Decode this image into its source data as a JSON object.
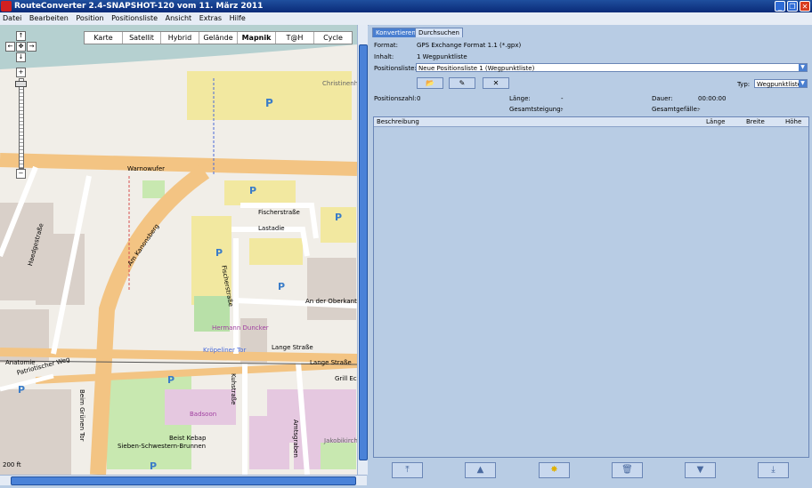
{
  "title": "RouteConverter 2.4-SNAPSHOT-120 vom 11. März 2011",
  "window_controls": {
    "minimize": "_",
    "maximize": "❐",
    "close": "✕"
  },
  "menu": [
    "Datei",
    "Bearbeiten",
    "Position",
    "Positionsliste",
    "Ansicht",
    "Extras",
    "Hilfe"
  ],
  "map": {
    "types": [
      "Karte",
      "Satellit",
      "Hybrid",
      "Gelände",
      "Mapnik",
      "T@H",
      "Cycle"
    ],
    "active_type": "Mapnik",
    "scale": "200 ft",
    "labels": [
      "Warnowufer",
      "Fischerstraße",
      "Lastadie",
      "Fischerstraße",
      "An der Oberkante",
      "Lange Straße",
      "Lange Straße",
      "Patriotischer Weg",
      "Am Kanonsberg",
      "Kröpeliner Tor",
      "Kuhstraße",
      "Beim Grünen Tor",
      "Sieben-Schwestern-Brunnen",
      "Beist Kebap",
      "Badsoon",
      "Amtsgraben",
      "Christinenhafen",
      "Hermann Duncker",
      "Haedgestraße",
      "Anatomie",
      "Grill Eck",
      "Jakobikirchplatz"
    ]
  },
  "panel": {
    "tabs": [
      "Konvertieren",
      "Durchsuchen"
    ],
    "format_label": "Format:",
    "format_value": "GPS Exchange Format 1.1 (*.gpx)",
    "content_label": "Inhalt:",
    "content_value": "1 Wegpunktliste",
    "list_label": "Positionsliste:",
    "list_value": "Neue Positionsliste 1 (Wegpunktliste)",
    "type_label": "Typ:",
    "type_value": "Wegpunktliste",
    "count_label": "Positionszahl:",
    "count_value": "0",
    "length_label": "Länge:",
    "length_value": "-",
    "duration_label": "Dauer:",
    "duration_value": "00:00:00",
    "ascent_label": "Gesamtsteigung:",
    "ascent_value": "-",
    "descent_label": "Gesamtgefälle:",
    "descent_value": "-",
    "columns": [
      "Beschreibung",
      "Länge",
      "Breite",
      "Höhe"
    ]
  },
  "colors": {
    "titlebar": "#0a2a78",
    "panel_bg": "#b8cce4",
    "accent": "#4a7fd0",
    "map_bg": "#f1eee8",
    "road_major": "#f3c483",
    "road_minor": "#ffffff"
  }
}
